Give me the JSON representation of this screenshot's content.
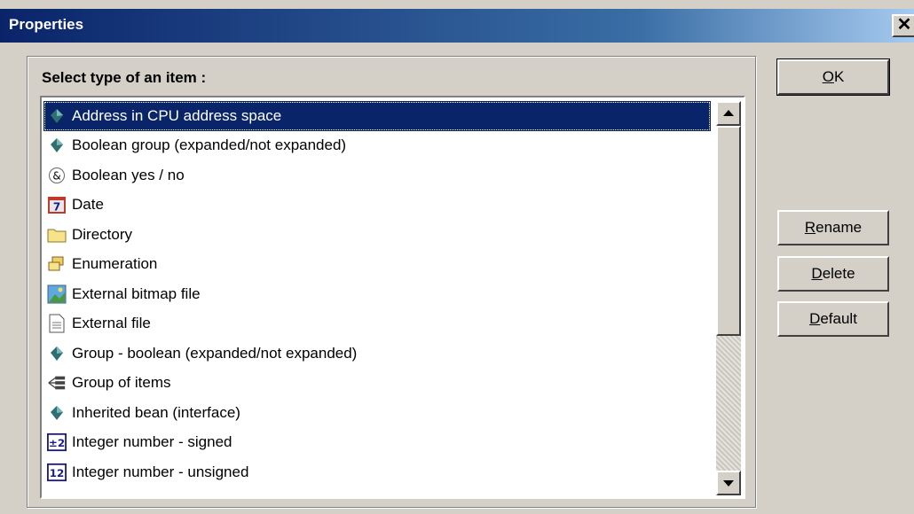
{
  "window": {
    "title": "Properties",
    "close_glyph": "✕"
  },
  "group": {
    "label": "Select type of an item :"
  },
  "list": {
    "items": [
      {
        "label": "Address in CPU address space",
        "icon": "diamond-icon",
        "selected": true
      },
      {
        "label": "Boolean group (expanded/not expanded)",
        "icon": "diamond-icon",
        "selected": false
      },
      {
        "label": "Boolean yes / no",
        "icon": "ampersand-icon",
        "selected": false
      },
      {
        "label": "Date",
        "icon": "calendar-icon",
        "selected": false
      },
      {
        "label": "Directory",
        "icon": "folder-icon",
        "selected": false
      },
      {
        "label": "Enumeration",
        "icon": "enumeration-icon",
        "selected": false
      },
      {
        "label": "External bitmap file",
        "icon": "bitmap-icon",
        "selected": false
      },
      {
        "label": "External file",
        "icon": "file-icon",
        "selected": false
      },
      {
        "label": "Group - boolean (expanded/not expanded)",
        "icon": "diamond-icon",
        "selected": false
      },
      {
        "label": "Group of items",
        "icon": "tree-icon",
        "selected": false
      },
      {
        "label": "Inherited bean (interface)",
        "icon": "diamond-icon",
        "selected": false
      },
      {
        "label": "Integer number - signed",
        "icon": "signed-integer-icon",
        "selected": false
      },
      {
        "label": "Integer number - unsigned",
        "icon": "unsigned-integer-icon",
        "selected": false
      }
    ]
  },
  "buttons": {
    "ok": {
      "mnemonic": "O",
      "rest": "K"
    },
    "rename": {
      "mnemonic": "R",
      "rest": "ename"
    },
    "delete": {
      "mnemonic": "D",
      "rest": "elete"
    },
    "default": {
      "mnemonic": "D",
      "rest": "efault"
    }
  },
  "colors": {
    "titlebar": "#0a246a",
    "face": "#d4d0c8",
    "selection": "#0a246a"
  }
}
